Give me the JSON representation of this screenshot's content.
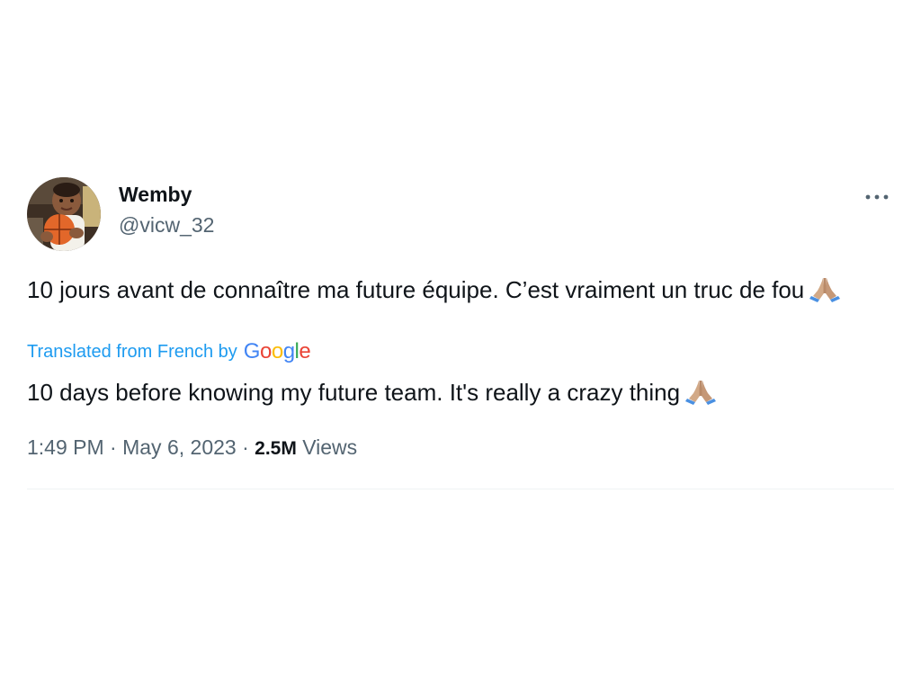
{
  "tweet": {
    "display_name": "Wemby",
    "handle": "@vicw_32",
    "more_icon": "more-horizontal-icon",
    "original_text": "10 jours avant de connaître ma future équipe. C’est vraiment un truc de fou",
    "original_emoji": "folded-hands-emoji",
    "translated_label": "Translated from French by",
    "translator_brand": {
      "letters": [
        "G",
        "o",
        "o",
        "g",
        "l",
        "e"
      ],
      "colors": [
        "#4285F4",
        "#EA4335",
        "#FBBC05",
        "#4285F4",
        "#34A853",
        "#EA4335"
      ]
    },
    "translated_text": "10 days before knowing my future team. It's really a crazy thing",
    "translated_emoji": "folded-hands-emoji",
    "time": "1:49 PM",
    "separator": " · ",
    "date": "May 6, 2023",
    "views_count": "2.5M",
    "views_label": "Views"
  },
  "colors": {
    "text_primary": "#0f1419",
    "text_secondary": "#536471",
    "link_blue": "#1d9bf0",
    "divider": "#eff3f4"
  }
}
